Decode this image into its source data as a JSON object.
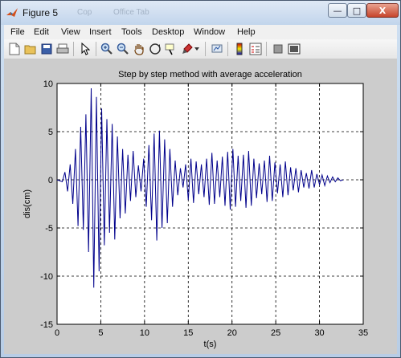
{
  "window": {
    "title": "Figure 5",
    "ghost_texts": [
      "Cop",
      "Office Tab"
    ],
    "buttons": {
      "minimize": "—",
      "maximize": "□",
      "close": "X"
    }
  },
  "menu": {
    "items": [
      "File",
      "Edit",
      "View",
      "Insert",
      "Tools",
      "Desktop",
      "Window",
      "Help"
    ]
  },
  "toolbar": {
    "icons": [
      "new-figure-icon",
      "open-file-icon",
      "save-icon",
      "print-icon",
      "edit-plot-arrow-icon",
      "zoom-in-icon",
      "zoom-out-icon",
      "pan-hand-icon",
      "rotate-3d-icon",
      "data-cursor-icon",
      "brush-icon",
      "link-plot-icon",
      "insert-colorbar-icon",
      "insert-legend-icon",
      "hide-plot-tools-icon",
      "show-plot-tools-icon"
    ]
  },
  "chart_data": {
    "type": "line",
    "title": "Step by step method with average acceleration",
    "xlabel": "t(s)",
    "ylabel": "dis(cm)",
    "xlim": [
      0,
      35
    ],
    "ylim": [
      -15,
      10
    ],
    "xticks": [
      0,
      5,
      10,
      15,
      20,
      25,
      30,
      35
    ],
    "yticks": [
      10,
      5,
      0,
      -5,
      -10,
      -15
    ],
    "grid": true,
    "line_color": "#00008b",
    "series": [
      {
        "x": [
          0,
          0.6,
          0.9,
          1.2,
          1.5,
          1.8,
          2.1,
          2.4,
          2.7,
          3.0,
          3.3,
          3.6,
          3.9,
          4.2,
          4.5,
          4.8,
          5.1,
          5.4,
          5.7,
          6.0,
          6.3,
          6.6,
          6.9,
          7.2,
          7.5,
          7.8,
          8.1,
          8.4,
          8.7,
          9.0,
          9.3,
          9.6,
          9.9,
          10.2,
          10.5,
          10.8,
          11.1,
          11.4,
          11.7,
          12.0,
          12.3,
          12.6,
          12.9,
          13.2,
          13.5,
          13.8,
          14.1,
          14.4,
          14.7,
          15.0,
          15.3,
          15.6,
          15.9,
          16.2,
          16.5,
          16.8,
          17.1,
          17.4,
          17.7,
          18.0,
          18.3,
          18.6,
          18.9,
          19.2,
          19.5,
          19.8,
          20.1,
          20.4,
          20.7,
          21.0,
          21.3,
          21.6,
          21.9,
          22.2,
          22.5,
          22.8,
          23.1,
          23.4,
          23.7,
          24.0,
          24.3,
          24.6,
          24.9,
          25.2,
          25.5,
          25.8,
          26.1,
          26.4,
          26.7,
          27.0,
          27.3,
          27.6,
          27.9,
          28.2,
          28.5,
          28.8,
          29.1,
          29.4,
          29.7,
          30.0,
          30.3,
          30.6,
          30.9,
          31.2,
          31.5,
          31.8,
          32.1,
          32.4,
          32.7
        ],
        "y": [
          0,
          -0.2,
          0.8,
          -1.2,
          1.6,
          -2.5,
          3.2,
          -4.8,
          5.5,
          -5.2,
          6.8,
          -7.5,
          9.5,
          -11.2,
          8.6,
          -9.5,
          7.4,
          -6.8,
          6.3,
          -5.5,
          5.8,
          -6.2,
          4.5,
          -4.0,
          3.2,
          -3.5,
          2.6,
          -2.2,
          3.0,
          -1.8,
          1.5,
          -1.2,
          2.2,
          -2.8,
          3.6,
          -4.2,
          4.8,
          -6.3,
          5.1,
          -5.0,
          4.2,
          -4.5,
          3.2,
          -2.8,
          2.0,
          -1.6,
          1.2,
          -0.8,
          1.6,
          -2.1,
          2.2,
          -2.4,
          1.9,
          -1.5,
          1.6,
          -1.8,
          2.2,
          -2.6,
          2.8,
          -2.5,
          2.0,
          -1.8,
          2.4,
          -2.7,
          2.9,
          -3.1,
          3.2,
          -2.8,
          2.5,
          -2.2,
          2.6,
          -2.9,
          3.0,
          -2.7,
          2.2,
          -1.9,
          1.7,
          -1.5,
          2.0,
          -2.3,
          2.5,
          -2.2,
          1.8,
          -1.4,
          1.6,
          -1.8,
          1.9,
          -1.6,
          1.3,
          -1.1,
          1.2,
          -1.3,
          1.0,
          -0.8,
          0.7,
          -0.9,
          1.0,
          -0.8,
          0.6,
          -0.5,
          0.5,
          -0.6,
          0.4,
          -0.3,
          0.3,
          -0.2,
          0.2,
          -0.1,
          0
        ]
      }
    ]
  }
}
